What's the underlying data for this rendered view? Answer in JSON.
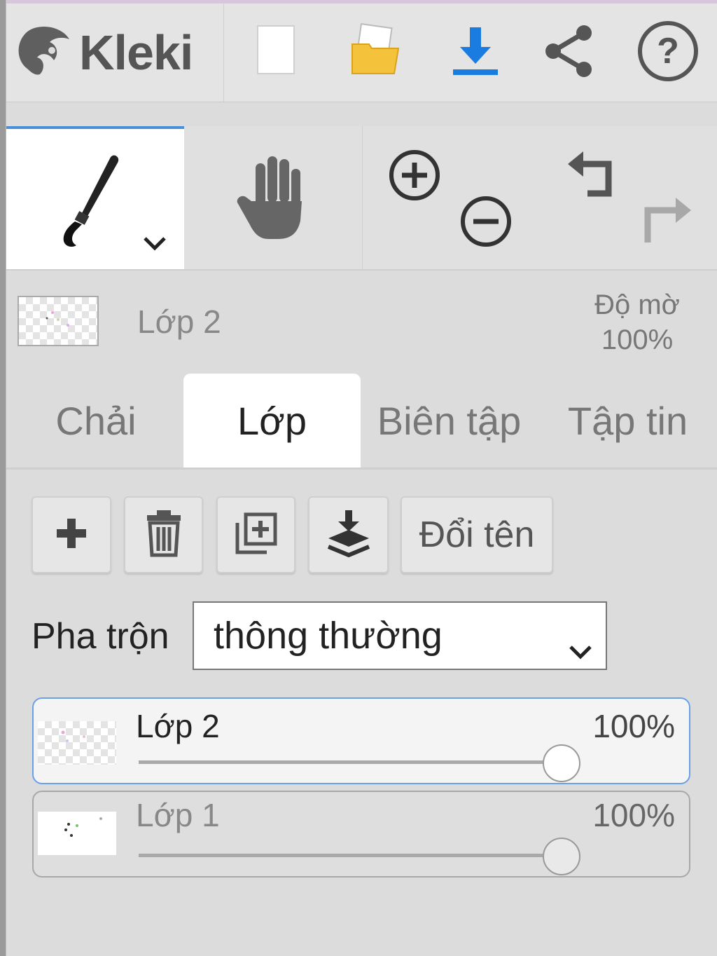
{
  "header": {
    "app_name": "Kleki",
    "icons": [
      "kleki-logo-icon",
      "new-file-icon",
      "open-folder-icon",
      "download-icon",
      "share-icon",
      "help-icon"
    ]
  },
  "tools": {
    "brush_icon": "brush-icon",
    "hand_icon": "hand-icon",
    "zoom_in_icon": "zoom-in-icon",
    "zoom_out_icon": "zoom-out-icon",
    "undo_icon": "undo-icon",
    "redo_icon": "redo-icon"
  },
  "layer_info": {
    "name": "Lớp 2",
    "opacity_label": "Độ mờ",
    "opacity_value": "100%"
  },
  "tabs": [
    {
      "label": "Chải",
      "active": false
    },
    {
      "label": "Lớp",
      "active": true
    },
    {
      "label": "Biên tập",
      "active": false
    },
    {
      "label": "Tập tin",
      "active": false
    }
  ],
  "layer_actions": {
    "rename_label": "Đổi tên",
    "icons": [
      "add-layer-icon",
      "delete-layer-icon",
      "duplicate-layer-icon",
      "merge-down-icon"
    ]
  },
  "blend": {
    "label": "Pha trộn",
    "value": "thông thường"
  },
  "layers": [
    {
      "name": "Lớp 2",
      "opacity": "100%",
      "opacity_fraction": 1.0,
      "selected": true
    },
    {
      "name": "Lớp 1",
      "opacity": "100%",
      "opacity_fraction": 1.0,
      "selected": false
    }
  ],
  "colors": {
    "accent": "#4a90d9",
    "download_blue": "#1a7be0",
    "folder_yellow": "#f5c33b"
  }
}
